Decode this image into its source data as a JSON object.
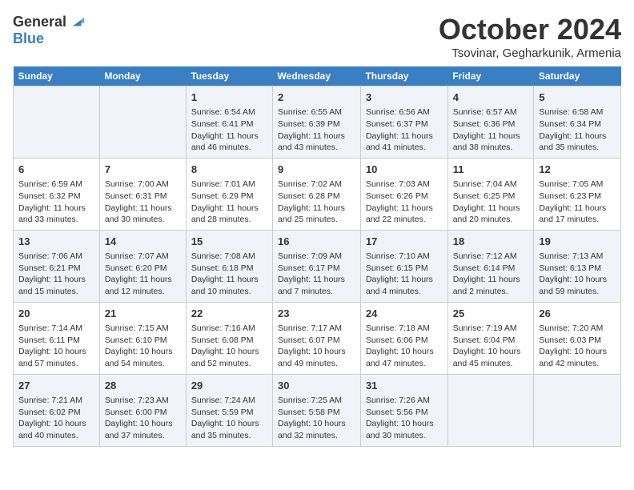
{
  "logo": {
    "general": "General",
    "blue": "Blue"
  },
  "title": "October 2024",
  "location": "Tsovinar, Gegharkunik, Armenia",
  "days_of_week": [
    "Sunday",
    "Monday",
    "Tuesday",
    "Wednesday",
    "Thursday",
    "Friday",
    "Saturday"
  ],
  "weeks": [
    [
      {
        "day": "",
        "content": ""
      },
      {
        "day": "",
        "content": ""
      },
      {
        "day": "1",
        "content": "Sunrise: 6:54 AM\nSunset: 6:41 PM\nDaylight: 11 hours and 46 minutes."
      },
      {
        "day": "2",
        "content": "Sunrise: 6:55 AM\nSunset: 6:39 PM\nDaylight: 11 hours and 43 minutes."
      },
      {
        "day": "3",
        "content": "Sunrise: 6:56 AM\nSunset: 6:37 PM\nDaylight: 11 hours and 41 minutes."
      },
      {
        "day": "4",
        "content": "Sunrise: 6:57 AM\nSunset: 6:36 PM\nDaylight: 11 hours and 38 minutes."
      },
      {
        "day": "5",
        "content": "Sunrise: 6:58 AM\nSunset: 6:34 PM\nDaylight: 11 hours and 35 minutes."
      }
    ],
    [
      {
        "day": "6",
        "content": "Sunrise: 6:59 AM\nSunset: 6:32 PM\nDaylight: 11 hours and 33 minutes."
      },
      {
        "day": "7",
        "content": "Sunrise: 7:00 AM\nSunset: 6:31 PM\nDaylight: 11 hours and 30 minutes."
      },
      {
        "day": "8",
        "content": "Sunrise: 7:01 AM\nSunset: 6:29 PM\nDaylight: 11 hours and 28 minutes."
      },
      {
        "day": "9",
        "content": "Sunrise: 7:02 AM\nSunset: 6:28 PM\nDaylight: 11 hours and 25 minutes."
      },
      {
        "day": "10",
        "content": "Sunrise: 7:03 AM\nSunset: 6:26 PM\nDaylight: 11 hours and 22 minutes."
      },
      {
        "day": "11",
        "content": "Sunrise: 7:04 AM\nSunset: 6:25 PM\nDaylight: 11 hours and 20 minutes."
      },
      {
        "day": "12",
        "content": "Sunrise: 7:05 AM\nSunset: 6:23 PM\nDaylight: 11 hours and 17 minutes."
      }
    ],
    [
      {
        "day": "13",
        "content": "Sunrise: 7:06 AM\nSunset: 6:21 PM\nDaylight: 11 hours and 15 minutes."
      },
      {
        "day": "14",
        "content": "Sunrise: 7:07 AM\nSunset: 6:20 PM\nDaylight: 11 hours and 12 minutes."
      },
      {
        "day": "15",
        "content": "Sunrise: 7:08 AM\nSunset: 6:18 PM\nDaylight: 11 hours and 10 minutes."
      },
      {
        "day": "16",
        "content": "Sunrise: 7:09 AM\nSunset: 6:17 PM\nDaylight: 11 hours and 7 minutes."
      },
      {
        "day": "17",
        "content": "Sunrise: 7:10 AM\nSunset: 6:15 PM\nDaylight: 11 hours and 4 minutes."
      },
      {
        "day": "18",
        "content": "Sunrise: 7:12 AM\nSunset: 6:14 PM\nDaylight: 11 hours and 2 minutes."
      },
      {
        "day": "19",
        "content": "Sunrise: 7:13 AM\nSunset: 6:13 PM\nDaylight: 10 hours and 59 minutes."
      }
    ],
    [
      {
        "day": "20",
        "content": "Sunrise: 7:14 AM\nSunset: 6:11 PM\nDaylight: 10 hours and 57 minutes."
      },
      {
        "day": "21",
        "content": "Sunrise: 7:15 AM\nSunset: 6:10 PM\nDaylight: 10 hours and 54 minutes."
      },
      {
        "day": "22",
        "content": "Sunrise: 7:16 AM\nSunset: 6:08 PM\nDaylight: 10 hours and 52 minutes."
      },
      {
        "day": "23",
        "content": "Sunrise: 7:17 AM\nSunset: 6:07 PM\nDaylight: 10 hours and 49 minutes."
      },
      {
        "day": "24",
        "content": "Sunrise: 7:18 AM\nSunset: 6:06 PM\nDaylight: 10 hours and 47 minutes."
      },
      {
        "day": "25",
        "content": "Sunrise: 7:19 AM\nSunset: 6:04 PM\nDaylight: 10 hours and 45 minutes."
      },
      {
        "day": "26",
        "content": "Sunrise: 7:20 AM\nSunset: 6:03 PM\nDaylight: 10 hours and 42 minutes."
      }
    ],
    [
      {
        "day": "27",
        "content": "Sunrise: 7:21 AM\nSunset: 6:02 PM\nDaylight: 10 hours and 40 minutes."
      },
      {
        "day": "28",
        "content": "Sunrise: 7:23 AM\nSunset: 6:00 PM\nDaylight: 10 hours and 37 minutes."
      },
      {
        "day": "29",
        "content": "Sunrise: 7:24 AM\nSunset: 5:59 PM\nDaylight: 10 hours and 35 minutes."
      },
      {
        "day": "30",
        "content": "Sunrise: 7:25 AM\nSunset: 5:58 PM\nDaylight: 10 hours and 32 minutes."
      },
      {
        "day": "31",
        "content": "Sunrise: 7:26 AM\nSunset: 5:56 PM\nDaylight: 10 hours and 30 minutes."
      },
      {
        "day": "",
        "content": ""
      },
      {
        "day": "",
        "content": ""
      }
    ]
  ]
}
